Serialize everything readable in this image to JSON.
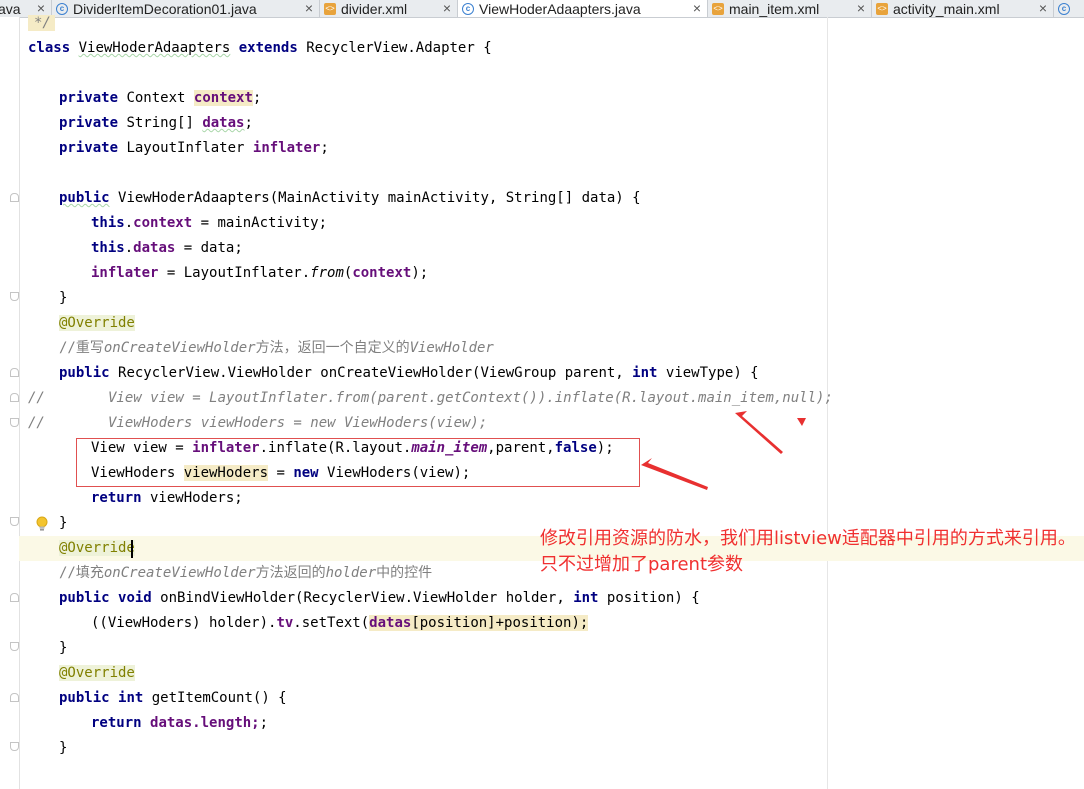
{
  "tabs": [
    {
      "label": "ava",
      "type": "java",
      "active": false
    },
    {
      "label": "DividerItemDecoration01.java",
      "type": "java",
      "active": false
    },
    {
      "label": "divider.xml",
      "type": "xml",
      "active": false
    },
    {
      "label": "ViewHoderAdaapters.java",
      "type": "java",
      "active": true
    },
    {
      "label": "main_item.xml",
      "type": "xml",
      "active": false
    },
    {
      "label": "activity_main.xml",
      "type": "xml",
      "active": false
    }
  ],
  "tab_close_glyph": "×",
  "code": {
    "line0": "*/",
    "cls_kw": "class",
    "cls_name": "ViewHoderAdaapters",
    "cls_ext": "extends",
    "cls_rest": "RecyclerView.Adapter {",
    "private_kw": "private",
    "public_kw": "public",
    "this_kw": "this",
    "return_kw": "return",
    "new_kw": "new",
    "int_kw": "int",
    "void_kw": "void",
    "false_kw": "false",
    "f1_type": "Context",
    "f1_name": "context",
    "f2_type": "String[]",
    "f2_name": "datas",
    "f3_type": "LayoutInflater",
    "f3_name": "inflater",
    "semi": ";",
    "ctor_rest": "ViewHoderAdaapters(MainActivity mainActivity, String[] data) {",
    "c1_rest": " = mainActivity;",
    "c2_rest": " = data;",
    "c3_a": " = LayoutInflater.",
    "c3_from": "from",
    "c3_b": ");",
    "brace_close": "}",
    "override": "@Override",
    "comment1_a": "//重写",
    "comment1_b": "onCreateViewHolder",
    "comment1_c": "方法，返回一个自定义的",
    "comment1_d": "ViewHolder",
    "ocvh_a": "RecyclerView.ViewHolder onCreateViewHolder(ViewGroup parent, ",
    "ocvh_b": " viewType) {",
    "cmt_slash": "//",
    "cl1": "View view = LayoutInflater.from(parent.getContext()).inflate(R.layout.main_item,null);",
    "cl2": "ViewHoders viewHoders = new ViewHoders(view);",
    "b1_a": "View view = ",
    "b1_b": ".inflate(R.layout.",
    "b1_c": "main_item",
    "b1_d": ",parent,",
    "b1_e": ");",
    "b2_a": "ViewHoders ",
    "b2_b": "viewHoders",
    "b2_c": " = ",
    "b2_d": " ViewHoders(view);",
    "ret1_rest": " viewHoders;",
    "comment2_a": "//填充",
    "comment2_b": "onCreateViewHolder",
    "comment2_c": "方法返回的",
    "comment2_d": "holder",
    "comment2_e": "中的控件",
    "obvh_a": "onBindViewHolder(RecyclerView.ViewHolder holder, ",
    "obvh_b": " position) {",
    "set_a": "((ViewHoders) holder).",
    "set_tv": "tv",
    "set_b": ".setText(",
    "set_c": "[position]+position);",
    "gic_a": "getItemCount() {",
    "ret2_b": ".length;",
    "lparen": "(",
    "dot": ".",
    "brace_plain": "}"
  },
  "annotation_note": "修改引用资源的防水，我们用listview适配器中引用的方式来引用。只不过增加了parent参数",
  "colors": {
    "keyword": "#000080",
    "field": "#660e7a",
    "comment": "#808080",
    "annotation": "#808000",
    "arrow": "#e83030"
  }
}
